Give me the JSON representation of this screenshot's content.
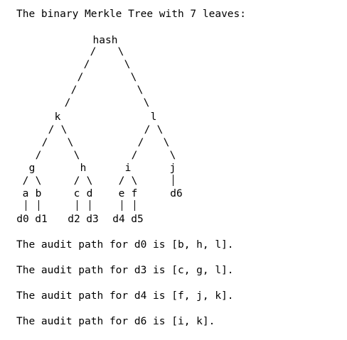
{
  "heading": "The binary Merkle Tree with 7 leaves:",
  "tree": {
    "root": "hash",
    "level1": [
      "k",
      "l"
    ],
    "level2": [
      "g",
      "h",
      "i",
      "j"
    ],
    "level3": [
      "a",
      "b",
      "c",
      "d",
      "e",
      "f"
    ],
    "leaves": [
      "d0",
      "d1",
      "d2",
      "d3",
      "d4",
      "d5",
      "d6"
    ]
  },
  "audit_paths": [
    "The audit path for d0 is [b, h, l].",
    "The audit path for d3 is [c, g, l].",
    "The audit path for d4 is [f, j, k].",
    "The audit path for d6 is [i, k]."
  ]
}
